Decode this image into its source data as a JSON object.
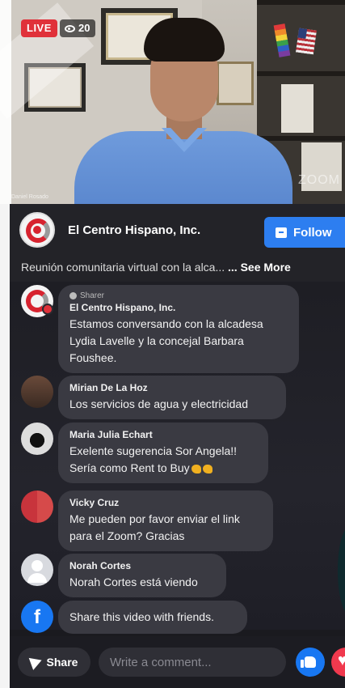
{
  "video": {
    "live_label": "LIVE",
    "viewer_count": "20",
    "watermark": "ZOOM",
    "participant_label": "Daniel Rosado"
  },
  "page": {
    "name": "El Centro Hispano, Inc.",
    "follow_label": "Follow",
    "description": "Reunión comunitaria virtual con la alca... ",
    "see_more": "... See More"
  },
  "comments": [
    {
      "badge": "Sharer",
      "author": "El Centro Hispano, Inc.",
      "text": "Estamos conversando con la alcadesa Lydia Lavelle y la concejal Barbara Foushee."
    },
    {
      "author": "Mirian De La Hoz",
      "text": "Los servicios de agua y electricidad"
    },
    {
      "author": "Maria Julia Echart",
      "line1": "Exelente sugerencia Sor Angela!!",
      "line2": "Sería como Rent to Buy"
    },
    {
      "author": "Vicky Cruz",
      "text": "Me pueden por favor enviar el link para el Zoom? Gracias"
    },
    {
      "author": "Norah Cortes",
      "text": "Norah Cortes está viendo"
    }
  ],
  "share_prompt": "Share this video with friends.",
  "bottom_bar": {
    "share_label": "Share",
    "comment_placeholder": "Write a comment..."
  },
  "colors": {
    "live": "#e0313a",
    "follow": "#2d7ef0",
    "bubble": "#3a3a42",
    "facebook": "#1877f2"
  }
}
